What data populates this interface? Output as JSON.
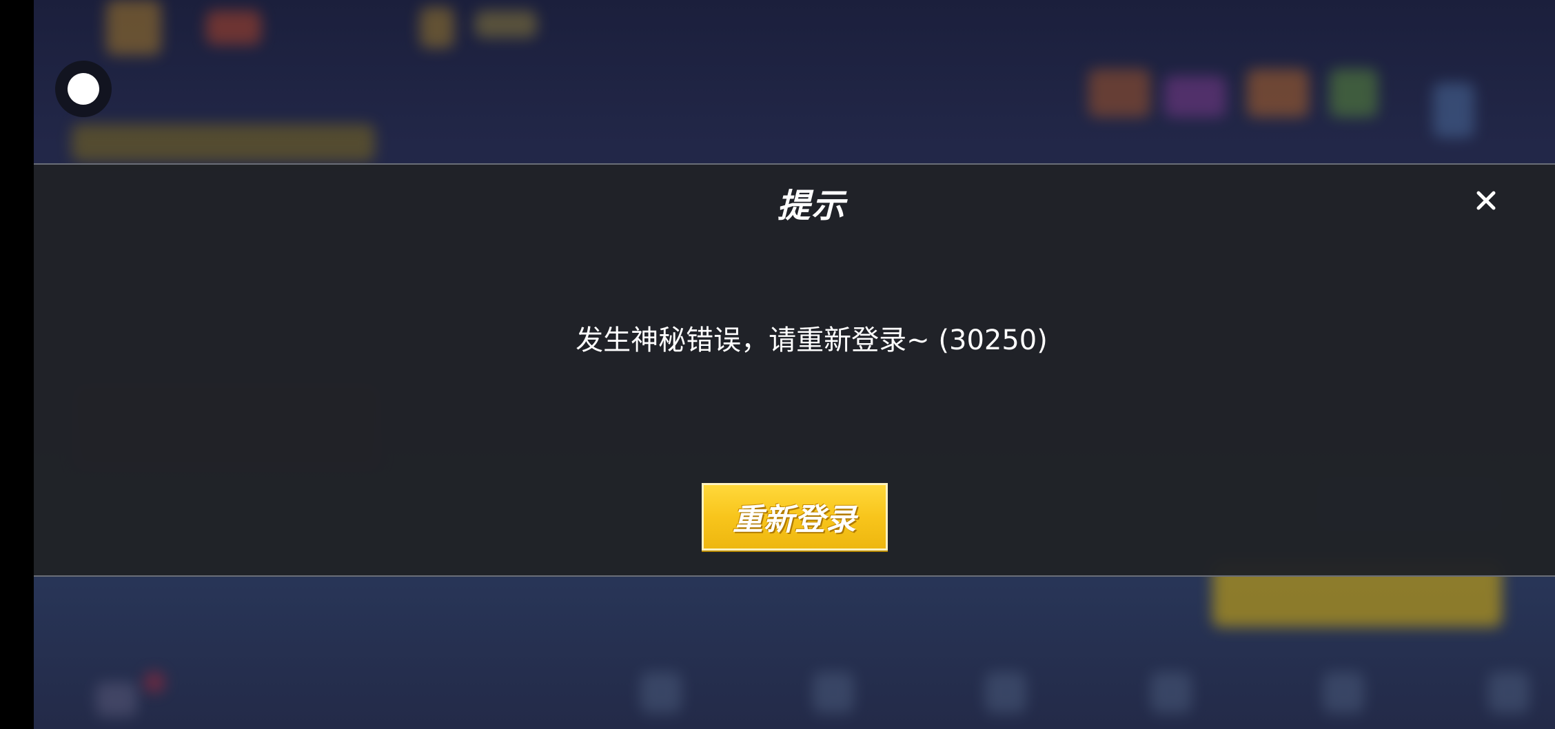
{
  "dialog": {
    "title": "提示",
    "message": "发生神秘错误，请重新登录~ (30250)",
    "button_label": "重新登录",
    "close_icon": "close-icon"
  },
  "floating_ball": {
    "icon": "assistive-touch-icon"
  },
  "colors": {
    "button_yellow": "#f8c51c",
    "overlay": "#202226",
    "background": "#222748"
  }
}
